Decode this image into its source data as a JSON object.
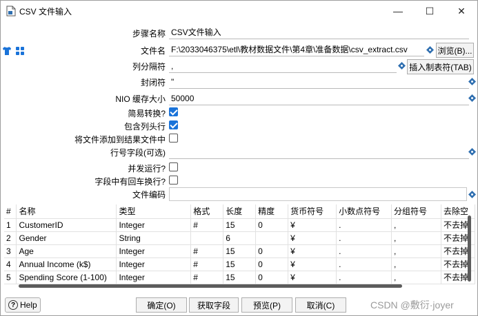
{
  "window": {
    "title": "CSV 文件输入",
    "controls": {
      "minimize": "—",
      "maximize": "☐",
      "close": "✕"
    }
  },
  "form": {
    "step_name_label": "步骤名称",
    "step_name_value": "CSV文件输入",
    "filename_label": "文件名",
    "filename_value": "F:\\2033046375\\etl\\教材数据文件\\第4章\\准备数据\\csv_extract.csv",
    "browse_button": "浏览(B)...",
    "delimiter_label": "列分隔符",
    "delimiter_value": ",",
    "insert_tab_button": "插入制表符(TAB)",
    "enclosure_label": "封闭符",
    "enclosure_value": "\"",
    "nio_label": "NIO 缓存大小",
    "nio_value": "50000",
    "lazy_label": "简易转换?",
    "lazy_checked": true,
    "header_label": "包含列头行",
    "header_checked": true,
    "add_result_label": "将文件添加到结果文件中",
    "add_result_checked": false,
    "rownum_label": "行号字段(可选)",
    "rownum_value": "",
    "parallel_label": "并发运行?",
    "parallel_checked": false,
    "newline_label": "字段中有回车换行?",
    "newline_checked": false,
    "encoding_label": "文件编码",
    "encoding_value": ""
  },
  "table": {
    "columns": [
      "#",
      "名称",
      "类型",
      "格式",
      "长度",
      "精度",
      "货币符号",
      "小数点符号",
      "分组符号",
      "去除空"
    ],
    "rows": [
      [
        "1",
        "CustomerID",
        "Integer",
        "#",
        "15",
        "0",
        "¥",
        ".",
        ",",
        "不去掉"
      ],
      [
        "2",
        "Gender",
        "String",
        "",
        "6",
        "",
        "¥",
        ".",
        ",",
        "不去掉"
      ],
      [
        "3",
        "Age",
        "Integer",
        "#",
        "15",
        "0",
        "¥",
        ".",
        ",",
        "不去掉"
      ],
      [
        "4",
        "Annual Income (k$)",
        "Integer",
        "#",
        "15",
        "0",
        "¥",
        ".",
        ",",
        "不去掉"
      ],
      [
        "5",
        "Spending Score (1-100)",
        "Integer",
        "#",
        "15",
        "0",
        "¥",
        ".",
        ",",
        "不去掉"
      ]
    ]
  },
  "footer": {
    "help": "Help",
    "ok": "确定(O)",
    "get_fields": "获取字段",
    "preview": "预览(P)",
    "cancel": "取消(C)"
  },
  "watermark": "CSDN @敷衍·joyer",
  "colors": {
    "accent": "#1a73d9",
    "var_icon": "#2f6fb0"
  }
}
